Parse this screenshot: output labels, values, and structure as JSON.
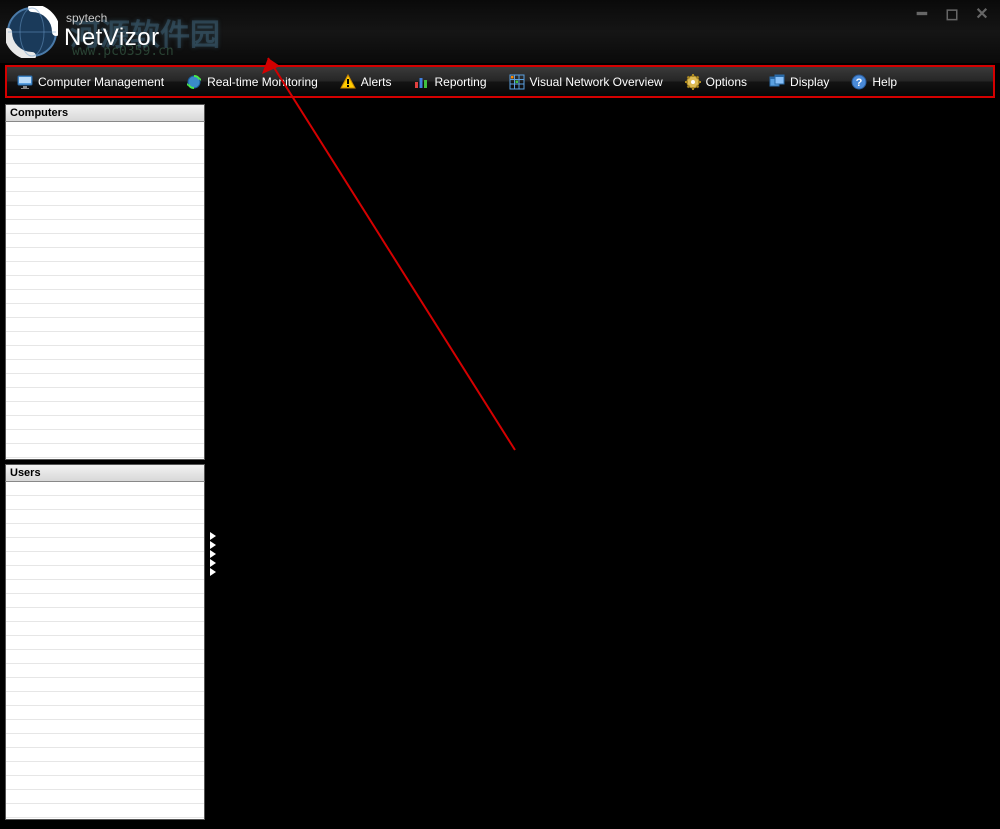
{
  "title": {
    "brand_small": "spytech",
    "brand_main": "NetVizor",
    "watermark_text": "河源软件园",
    "watermark_url": "www.pc0359.cn"
  },
  "toolbar": [
    {
      "label": "Computer Management",
      "icon": "monitor-icon"
    },
    {
      "label": "Real-time Monitoring",
      "icon": "globe-refresh-icon"
    },
    {
      "label": "Alerts",
      "icon": "warning-icon"
    },
    {
      "label": "Reporting",
      "icon": "chart-icon"
    },
    {
      "label": "Visual Network Overview",
      "icon": "grid-icon"
    },
    {
      "label": "Options",
      "icon": "gear-icon"
    },
    {
      "label": "Display",
      "icon": "windows-icon"
    },
    {
      "label": "Help",
      "icon": "help-icon"
    }
  ],
  "panels": {
    "computers": {
      "header": "Computers",
      "row_count": 24
    },
    "users": {
      "header": "Users",
      "row_count": 24
    }
  }
}
